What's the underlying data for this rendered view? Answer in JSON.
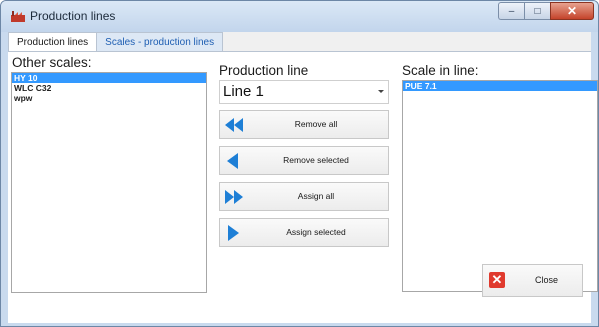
{
  "window": {
    "title": "Production lines",
    "controls": {
      "minimize": "–",
      "maximize": "□",
      "close": "✕"
    }
  },
  "tabs": [
    {
      "label": "Production lines",
      "active": false
    },
    {
      "label": "Scales - production lines",
      "active": true
    }
  ],
  "other_scales": {
    "label": "Other scales:",
    "items": [
      {
        "label": "HY 10",
        "selected": true
      },
      {
        "label": "WLC C32",
        "selected": false
      },
      {
        "label": "wpw",
        "selected": false
      }
    ]
  },
  "production_line": {
    "label": "Production line",
    "selected_value": "Line 1"
  },
  "actions": {
    "remove_all": "Remove all",
    "remove_selected": "Remove selected",
    "assign_all": "Assign all",
    "assign_selected": "Assign selected"
  },
  "scale_in_line": {
    "label": "Scale in line:",
    "items": [
      {
        "label": "PUE 7.1",
        "selected": true
      }
    ]
  },
  "footer": {
    "close_label": "Close"
  },
  "colors": {
    "accent": "#3399ff",
    "icon_blue": "#1e7fd6",
    "close_red": "#e03a2e"
  }
}
